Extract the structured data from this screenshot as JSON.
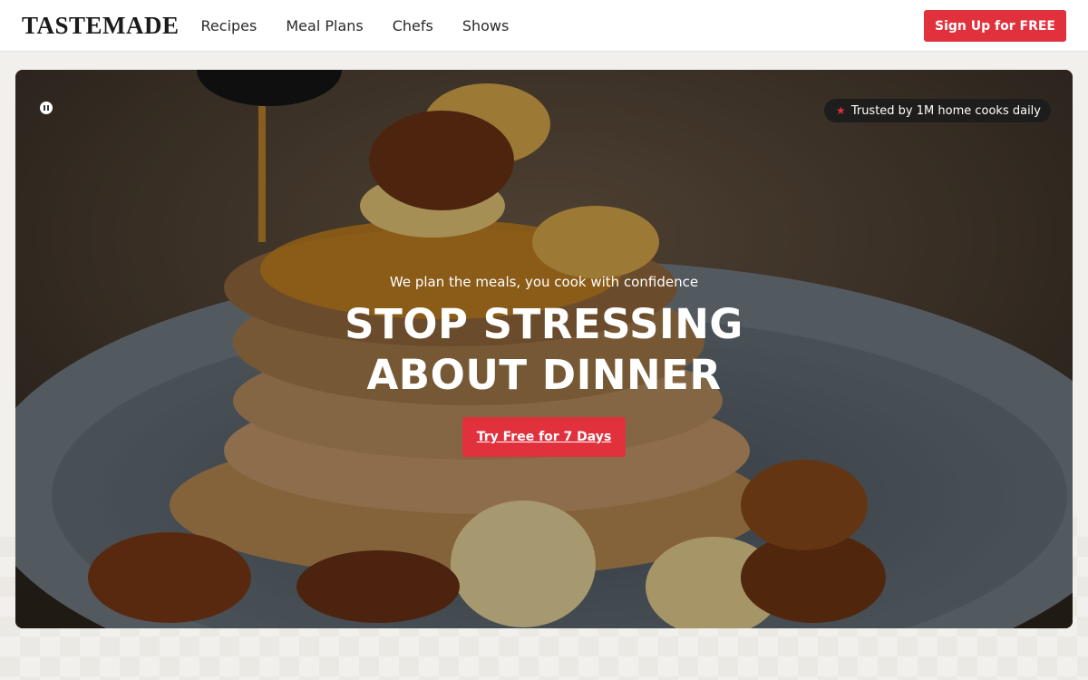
{
  "header": {
    "logo": "TASTEMADE",
    "nav": [
      "Recipes",
      "Meal Plans",
      "Chefs",
      "Shows"
    ],
    "signup_label": "Sign Up for FREE"
  },
  "hero": {
    "badge": "Trusted by 1M home cooks daily",
    "tagline": "We plan the meals, you cook with confidence",
    "headline_line1": "STOP STRESSING",
    "headline_line2": "ABOUT DINNER",
    "cta_label": "Try Free for 7 Days"
  },
  "colors": {
    "accent": "#e0313d",
    "header_bg": "#ffffff",
    "page_bg": "#f1f0ec"
  },
  "icons": {
    "pause": "pause-icon",
    "star": "star-icon"
  }
}
